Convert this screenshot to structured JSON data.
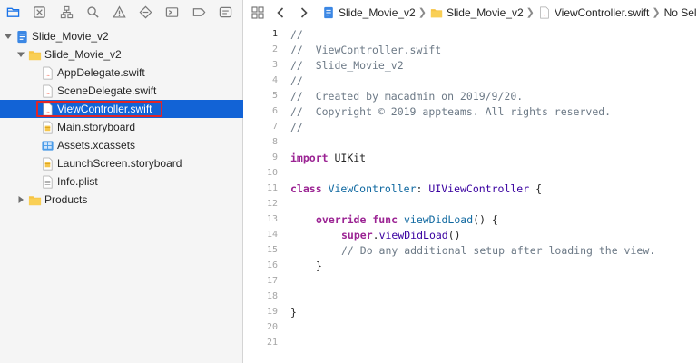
{
  "navigator": {
    "toolbar_icons": [
      "folder-icon",
      "close-square-icon",
      "hierarchy-icon",
      "search-icon",
      "warning-icon",
      "test-diamond-icon",
      "debug-icon",
      "breakpoint-icon",
      "report-icon"
    ],
    "tree": [
      {
        "label": "Slide_Movie_v2",
        "icon": "project-icon",
        "expanded": true,
        "depth": 0
      },
      {
        "label": "Slide_Movie_v2",
        "icon": "folder-icon",
        "expanded": true,
        "depth": 1
      },
      {
        "label": "AppDelegate.swift",
        "icon": "swift-file-icon",
        "depth": 2
      },
      {
        "label": "SceneDelegate.swift",
        "icon": "swift-file-icon",
        "depth": 2
      },
      {
        "label": "ViewController.swift",
        "icon": "swift-file-icon",
        "depth": 2,
        "selected": true
      },
      {
        "label": "Main.storyboard",
        "icon": "storyboard-icon",
        "depth": 2
      },
      {
        "label": "Assets.xcassets",
        "icon": "assets-icon",
        "depth": 2
      },
      {
        "label": "LaunchScreen.storyboard",
        "icon": "storyboard-icon",
        "depth": 2
      },
      {
        "label": "Info.plist",
        "icon": "plist-icon",
        "depth": 2
      },
      {
        "label": "Products",
        "icon": "folder-icon",
        "expanded": false,
        "depth": 1
      }
    ]
  },
  "jumpbar": {
    "project": "Slide_Movie_v2",
    "group": "Slide_Movie_v2",
    "file": "ViewController.swift",
    "selection": "No Selection"
  },
  "editor": {
    "current_line": 1,
    "lines": [
      {
        "n": "1",
        "text": "//"
      },
      {
        "n": "2",
        "text": "//  ViewController.swift"
      },
      {
        "n": "3",
        "text": "//  Slide_Movie_v2"
      },
      {
        "n": "4",
        "text": "//"
      },
      {
        "n": "5",
        "text": "//  Created by macadmin on 2019/9/20."
      },
      {
        "n": "6",
        "text": "//  Copyright © 2019 appteams. All rights reserved."
      },
      {
        "n": "7",
        "text": "//"
      },
      {
        "n": "8",
        "text": ""
      },
      {
        "n": "9",
        "text": "import UIKit"
      },
      {
        "n": "10",
        "text": ""
      },
      {
        "n": "11",
        "text": "class ViewController: UIViewController {"
      },
      {
        "n": "12",
        "text": ""
      },
      {
        "n": "13",
        "text": "    override func viewDidLoad() {"
      },
      {
        "n": "14",
        "text": "        super.viewDidLoad()"
      },
      {
        "n": "15",
        "text": "        // Do any additional setup after loading the view."
      },
      {
        "n": "16",
        "text": "    }"
      },
      {
        "n": "17",
        "text": ""
      },
      {
        "n": "18",
        "text": ""
      },
      {
        "n": "19",
        "text": "}"
      },
      {
        "n": "20",
        "text": ""
      },
      {
        "n": "21",
        "text": ""
      }
    ],
    "tokens": {
      "import_kw": "import",
      "uikit": "UIKit",
      "class_kw": "class",
      "class_name": "ViewController",
      "colon": ":",
      "superclass": "UIViewController",
      "brace_open": "{",
      "override_kw": "override",
      "func_kw": "func",
      "method": "viewDidLoad",
      "parens_brace": "() {",
      "super_kw": "super",
      "dot": ".",
      "call": "viewDidLoad",
      "call_parens": "()",
      "comment15": "// Do any additional setup after loading the view.",
      "brace_close": "}"
    }
  },
  "colors": {
    "selection": "#1263d6",
    "highlight_border": "#e0262a",
    "comment": "#6c7986",
    "keyword": "#9b2393",
    "type": "#3900a0",
    "function": "#0f68a0"
  }
}
